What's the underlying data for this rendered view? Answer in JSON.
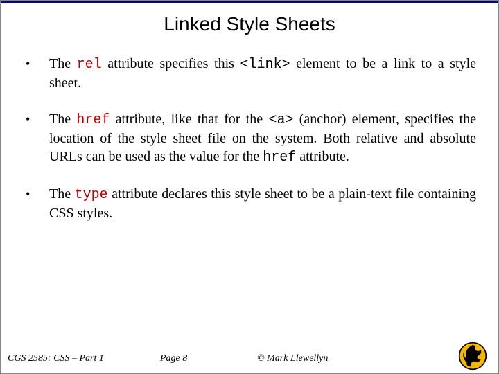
{
  "title": "Linked Style Sheets",
  "bullets": [
    {
      "t1": "The ",
      "code1": "rel",
      "t2": " attribute specifies this ",
      "code2": "<link>",
      "t3": " element to be a link to a style sheet."
    },
    {
      "t1": "The ",
      "code1": "href",
      "t2": " attribute, like that for the ",
      "code2": "<a>",
      "t3": " (anchor) element, specifies the location of the style sheet file on the system. Both relative and absolute URLs can be used as the value for the ",
      "code3": "href",
      "t4": " attribute."
    },
    {
      "t1": "The ",
      "code1": "type",
      "t2": " attribute declares this style sheet to be a plain-text file containing CSS styles."
    }
  ],
  "footer": {
    "course": "CGS 2585: CSS – Part 1",
    "page": "Page 8",
    "copyright": "© Mark Llewellyn"
  },
  "glyphs": {
    "bullet": "•"
  }
}
